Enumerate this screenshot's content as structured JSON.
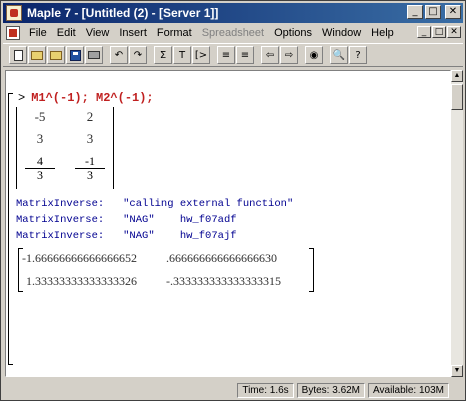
{
  "window": {
    "title": "Maple 7 - [Untitled (2) - [Server 1]]",
    "accent": "#0a246a"
  },
  "title_buttons": {
    "minimize": "_",
    "maximize": "□",
    "close": "✕"
  },
  "menu": {
    "items": [
      "File",
      "Edit",
      "View",
      "Insert",
      "Format",
      "Spreadsheet",
      "Options",
      "Window",
      "Help"
    ],
    "disabled_index": 5
  },
  "toolbar": {
    "icons": [
      "new-icon",
      "open-icon",
      "open-url-icon",
      "save-icon",
      "print-icon",
      "undo-icon",
      "redo-icon",
      "sigma-icon",
      "text-icon",
      "prompt-icon",
      "indent-icon",
      "outdent-icon",
      "back-icon",
      "forward-icon",
      "stop-icon",
      "zoom-icon",
      "help-icon"
    ],
    "glyphs": {
      "undo": "↶",
      "redo": "↷",
      "sigma": "Σ",
      "text": "T",
      "prompt": "[>",
      "indent": "≡",
      "outdent": "≡",
      "back": "⇦",
      "forward": "⇨",
      "stop": "◉",
      "zoom": "🔍",
      "help": "?"
    }
  },
  "worksheet": {
    "prompt": ">",
    "input": "M1^(-1); M2^(-1);",
    "input_color": "#c02020",
    "matrix1": {
      "r1c1": "-5",
      "r1c2": "2",
      "r2c1": "3",
      "r2c2": "3",
      "r3c1_num": "4",
      "r3c1_den": "3",
      "r3c2_num": "-1",
      "r3c2_den": "3"
    },
    "info_lines": [
      {
        "label": "MatrixInverse:",
        "text": "\"calling external function\""
      },
      {
        "label": "MatrixInverse:",
        "text": "\"NAG\"    hw_f07adf"
      },
      {
        "label": "MatrixInverse:",
        "text": "\"NAG\"    hw_f07ajf"
      }
    ],
    "matrix2": {
      "r1c1": "-1.66666666666666652",
      "r1c2": ".666666666666666630",
      "r2c1": "1.33333333333333326",
      "r2c2": "-.333333333333333315"
    }
  },
  "status": {
    "time": "Time: 1.6s",
    "bytes": "Bytes: 3.62M",
    "available": "Available: 103M"
  }
}
